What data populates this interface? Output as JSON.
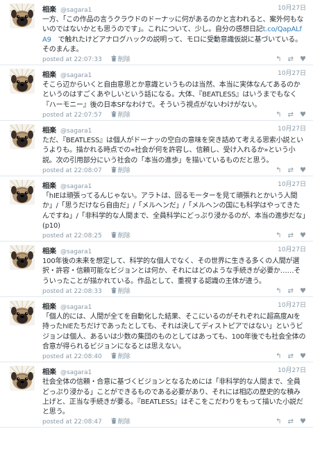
{
  "tweets": [
    {
      "name": "相楽",
      "handle": "@sagara1",
      "date": "10月27日",
      "text": "一方、「この作品の言うクラウドのドーナッに何があるのかと言われると、案外何もないのではないかとも思うのです」。これについて、少し。自分の感想日記",
      "link": "t.co/QapALfA9",
      "text_after": "　で触れたけどアナログハックの説明って、モロに受動意識仮説に基づいている。そのまんま。",
      "posted": "posted at 22:07:33",
      "delete": "削除"
    },
    {
      "name": "相楽",
      "handle": "@sagara1",
      "date": "10月27日",
      "text": "そこら辺からいくと自由意思とか意識というものは当然、本当に実体なんてあるのかというのはすごくあやしいという話になる。大体、『BEATLESS』はいうまでもなく『ハーモニー』後の日本SFなわけで。そういう視点がないわけがない。",
      "posted": "posted at 22:07:57",
      "delete": "削除"
    },
    {
      "name": "相楽",
      "handle": "@sagara1",
      "date": "10月27日",
      "text": "ただ、『BEATLESS』は個人がドーナッの空白の意味を突き詰めて考える思索小説というよりも。描かれる時点での«社会が何を許容し、信頼し、受け入れるか»という小説。次の引用部分にいう社会の「本当の進歩」を描いているものだと思う。",
      "posted": "posted at 22:08:07",
      "delete": "削除"
    },
    {
      "name": "相楽",
      "handle": "@sagara1",
      "date": "10月27日",
      "text": "「hIEは頑張ってるんじゃない。アラトは、回るモーターを見て頑張れとかいう人間か」/「思うだけなら自由だ」/「メルヘンだ」/「メルヘンの国にも科学はやってきたんですね」/「非科学的な人間まで、全員科学にどっぷり浸かるのが、本当の進歩だな」(p10)",
      "posted": "posted at 22:08:25",
      "delete": "削除"
    },
    {
      "name": "相楽",
      "handle": "@sagara1",
      "date": "10月27日",
      "text": "100年後の未来を想定して、科学的な個人でなく、その世界に生きる多くの人間が選択・許容・信頼可能なビジョンとは何か、それにはどのような手続きが必要か……そういったことが描かれている。作品として、重視する認識の主体が違う。",
      "posted": "posted at 22:08:33",
      "delete": "削除"
    },
    {
      "name": "相楽",
      "handle": "@sagara1",
      "date": "10月27日",
      "text": "「個人的には、人間が全てを自動化した結果、そこにいるのがそれぞれに超高度AIを持ったhIEたちだけであったとしても、それは決してディストピアではない」というビジョンは個人、あるいは少数の集団のものとしてはあっても、100年後でも社会全体の合意が得られるビジョンになるとは思えない。",
      "posted": "posted at 22:08:40",
      "delete": "削除"
    },
    {
      "name": "相楽",
      "handle": "@sagara1",
      "date": "10月27日",
      "text": "社会全体の信頼・合意に基づくビジョンとなるためには「非科学的な人間まで、全員どっぷり浸かる」ことができるものである必要があり、それには相応の歴史的な積み上げと、正当な手続きが要る。『BEATLESS』はそこをこだわりをもって描いた小説だと思う。",
      "posted": "posted at 22:08:47",
      "delete": "削除"
    }
  ],
  "icons": {
    "avatar": "pug-dog-avatar",
    "trash": "trash-icon",
    "reply": "reply-icon",
    "retweet": "retweet-icon",
    "favorite": "heart-icon"
  },
  "colors": {
    "link": "#2b7bb9",
    "meta": "#8899a6",
    "text": "#292f33"
  }
}
